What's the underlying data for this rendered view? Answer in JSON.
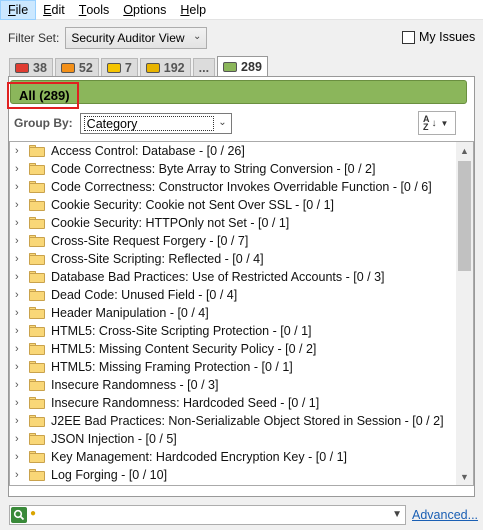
{
  "menu": [
    {
      "label": "File",
      "key": "F",
      "rest": "ile",
      "active": true
    },
    {
      "label": "Edit",
      "key": "E",
      "rest": "dit"
    },
    {
      "label": "Tools",
      "key": "T",
      "rest": "ools"
    },
    {
      "label": "Options",
      "key": "O",
      "rest": "ptions"
    },
    {
      "label": "Help",
      "key": "H",
      "rest": "elp"
    }
  ],
  "filter": {
    "label": "Filter Set:",
    "selected": "Security Auditor View",
    "my_issues_label": "My Issues",
    "my_issues_checked": false
  },
  "tabs": [
    {
      "count": "38",
      "color": "#e03c31"
    },
    {
      "count": "52",
      "color": "#f39019"
    },
    {
      "count": "7",
      "color": "#f5c400"
    },
    {
      "count": "192",
      "color": "#e8b400"
    },
    {
      "count": "...",
      "color": ""
    },
    {
      "count": "289",
      "color": "#8bb65b",
      "selected": true
    }
  ],
  "all_label": "All (289)",
  "group_by": {
    "label": "Group By:",
    "selected": "Category"
  },
  "tree_items": [
    "Access Control: Database - [0 / 26]",
    "Code Correctness: Byte Array to String Conversion - [0 / 2]",
    "Code Correctness: Constructor Invokes Overridable Function - [0 / 6]",
    "Cookie Security: Cookie not Sent Over SSL - [0 / 1]",
    "Cookie Security: HTTPOnly not Set - [0 / 1]",
    "Cross-Site Request Forgery - [0 / 7]",
    "Cross-Site Scripting: Reflected - [0 / 4]",
    "Database Bad Practices: Use of Restricted Accounts - [0 / 3]",
    "Dead Code: Unused Field - [0 / 4]",
    "Header Manipulation - [0 / 4]",
    "HTML5: Cross-Site Scripting Protection - [0 / 1]",
    "HTML5: Missing Content Security Policy - [0 / 2]",
    "HTML5: Missing Framing Protection - [0 / 1]",
    "Insecure Randomness - [0 / 3]",
    "Insecure Randomness: Hardcoded Seed - [0 / 1]",
    "J2EE Bad Practices: Non-Serializable Object Stored in Session - [0 / 2]",
    "JSON Injection - [0 / 5]",
    "Key Management: Hardcoded Encryption Key - [0 / 1]",
    "Log Forging - [0 / 10]"
  ],
  "advanced_label": "Advanced..."
}
